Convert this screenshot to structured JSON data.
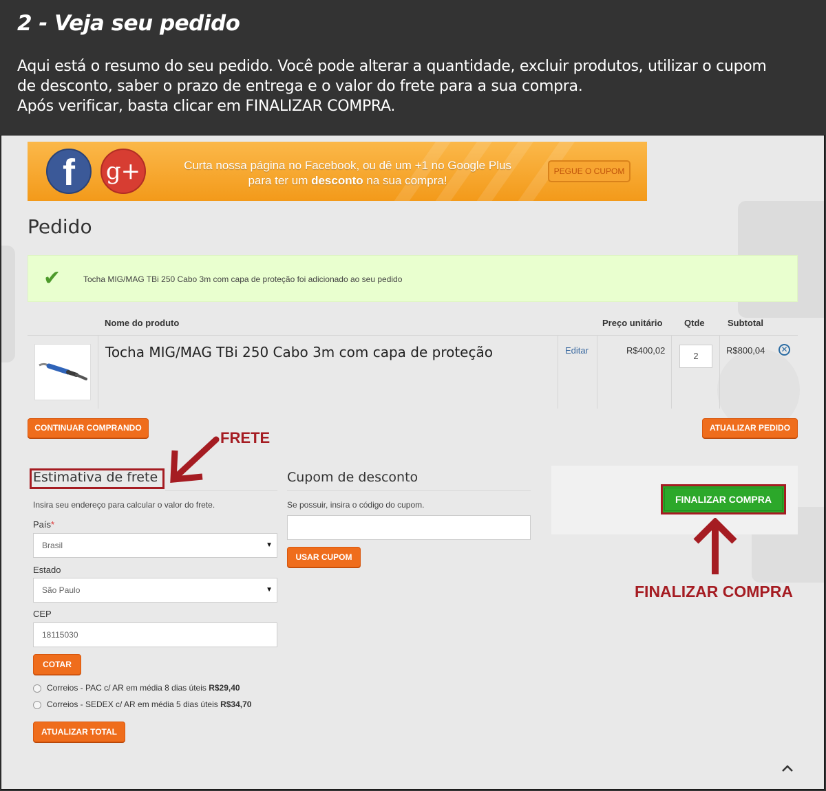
{
  "header": {
    "title": "2 - Veja seu pedido",
    "lines": [
      "Aqui está o resumo do seu pedido. Você pode alterar a quantidade, excluir produtos, utilizar o cupom",
      "de desconto, saber o prazo de entrega e o valor do frete para a sua compra.",
      "Após verificar, basta clicar em FINALIZAR COMPRA."
    ]
  },
  "banner": {
    "facebook_icon": "f",
    "gplus_icon": "g+",
    "line1": "Curta nossa página no Facebook, ou dê um +1 no Google Plus",
    "line2_pre": "para ter um ",
    "line2_bold": "desconto",
    "line2_post": " na sua compra!",
    "button": "PEGUE O CUPOM"
  },
  "page_title": "Pedido",
  "alert": {
    "icon": "check-icon",
    "text": "Tocha MIG/MAG TBi 250 Cabo 3m com capa de proteção foi adicionado ao seu pedido"
  },
  "cart": {
    "headers": {
      "name": "Nome do produto",
      "unit_price": "Preço unitário",
      "qty": "Qtde",
      "subtotal": "Subtotal"
    },
    "items": [
      {
        "name": "Tocha MIG/MAG TBi 250 Cabo 3m com capa de proteção",
        "edit": "Editar",
        "unit_price": "R$400,02",
        "qty": "2",
        "subtotal": "R$800,04"
      }
    ],
    "continue_button": "CONTINUAR COMPRANDO",
    "update_button": "ATUALIZAR PEDIDO"
  },
  "annotations": {
    "frete": "FRETE",
    "finalizar": "FINALIZAR COMPRA"
  },
  "shipping": {
    "title": "Estimativa de frete",
    "hint": "Insira seu endereço para calcular o valor do frete.",
    "country_label": "País",
    "required_mark": "*",
    "country_value": "Brasil",
    "state_label": "Estado",
    "state_value": "São Paulo",
    "cep_label": "CEP",
    "cep_value": "18115030",
    "quote_button": "COTAR",
    "options": [
      {
        "label": "Correios - PAC c/ AR em média 8 dias úteis ",
        "price": "R$29,40"
      },
      {
        "label": "Correios - SEDEX c/ AR em média 5 dias úteis ",
        "price": "R$34,70"
      }
    ],
    "update_total_button": "ATUALIZAR TOTAL"
  },
  "coupon": {
    "title": "Cupom de desconto",
    "hint": "Se possuir, insira o código do cupom.",
    "input_value": "",
    "button": "USAR CUPOM"
  },
  "checkout_button": "FINALIZAR COMPRA",
  "colors": {
    "header_bg": "#333333",
    "orange": "#ef6d1c",
    "green": "#2ca82a",
    "annotation_red": "#a51c22",
    "alert_bg": "#e9ffcf",
    "link_blue": "#3b6aa0"
  }
}
